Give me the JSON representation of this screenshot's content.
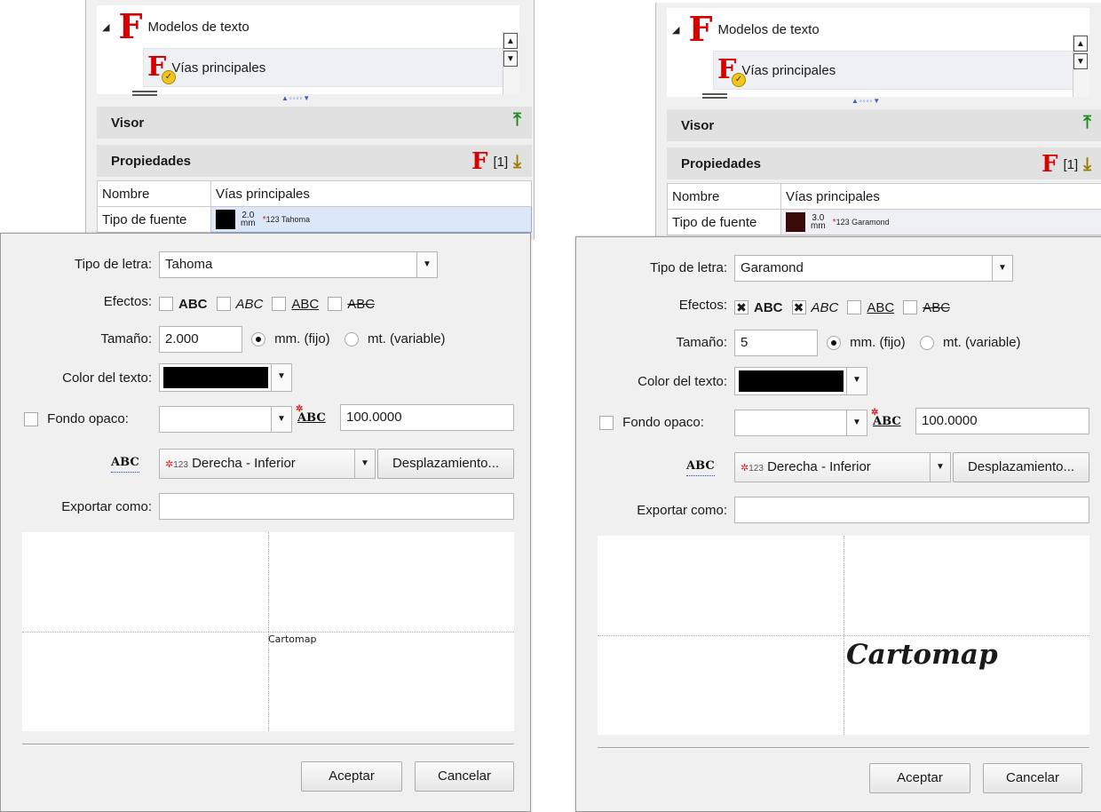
{
  "left": {
    "tree": {
      "root_label": "Modelos de texto",
      "child_label": "Vías principales"
    },
    "sections": {
      "visor": "Visor",
      "propiedades": "Propiedades",
      "count": "[1]"
    },
    "props": {
      "rows": [
        {
          "key": "Nombre",
          "value": "Vías principales"
        },
        {
          "key": "Tipo de fuente",
          "size_top": "2.0",
          "size_unit": "mm",
          "font_tag": "123 Tahoma"
        }
      ]
    },
    "dialog": {
      "font_label": "Tipo de letra:",
      "font_value": "Tahoma",
      "effects_label": "Efectos:",
      "effects": [
        {
          "text": "ABC",
          "style": "bold",
          "checked": false
        },
        {
          "text": "ABC",
          "style": "italic",
          "checked": false
        },
        {
          "text": "ABC",
          "style": "underline",
          "checked": false
        },
        {
          "text": "ABC",
          "style": "strike",
          "checked": false
        }
      ],
      "size_label": "Tamaño:",
      "size_value": "2.000",
      "unit_fixed": "mm. (fijo)",
      "unit_variable": "mt. (variable)",
      "color_label": "Color del texto:",
      "bg_label": "Fondo opaco:",
      "bg_value": "100.0000",
      "position_value": "Derecha - Inferior",
      "position_prefix": "123",
      "offset_button": "Desplazamiento...",
      "export_label": "Exportar como:",
      "export_value": "",
      "preview_text": "Cartomap",
      "accept": "Aceptar",
      "cancel": "Cancelar"
    }
  },
  "right": {
    "tree": {
      "root_label": "Modelos de texto",
      "child_label": "Vías principales"
    },
    "sections": {
      "visor": "Visor",
      "propiedades": "Propiedades",
      "count": "[1]"
    },
    "props": {
      "rows": [
        {
          "key": "Nombre",
          "value": "Vías principales"
        },
        {
          "key": "Tipo de fuente",
          "size_top": "3.0",
          "size_unit": "mm",
          "font_tag": "123 Garamond"
        }
      ]
    },
    "dialog": {
      "font_label": "Tipo de letra:",
      "font_value": "Garamond",
      "effects_label": "Efectos:",
      "effects": [
        {
          "text": "ABC",
          "style": "bold",
          "checked": true
        },
        {
          "text": "ABC",
          "style": "italic",
          "checked": true
        },
        {
          "text": "ABC",
          "style": "underline",
          "checked": false
        },
        {
          "text": "ABC",
          "style": "strike",
          "checked": false
        }
      ],
      "size_label": "Tamaño:",
      "size_value": "5",
      "unit_fixed": "mm. (fijo)",
      "unit_variable": "mt. (variable)",
      "color_label": "Color del texto:",
      "bg_label": "Fondo opaco:",
      "bg_value": "100.0000",
      "position_value": "Derecha - Inferior",
      "position_prefix": "123",
      "offset_button": "Desplazamiento...",
      "export_label": "Exportar como:",
      "export_value": "",
      "preview_text": "Cartomap",
      "accept": "Aceptar",
      "cancel": "Cancelar"
    }
  },
  "colors": {
    "text_color_left": "#000000",
    "text_color_right": "#000000",
    "swatch_left": "#000000",
    "swatch_right": "#3a0a0a",
    "accent_red": "#d60000"
  }
}
